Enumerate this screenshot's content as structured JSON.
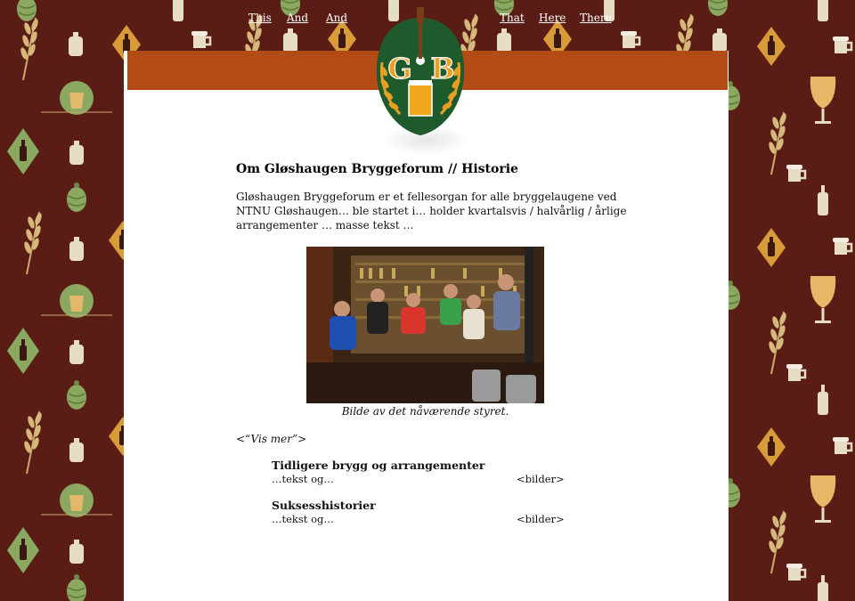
{
  "nav": {
    "left": [
      "This",
      "And",
      "And"
    ],
    "right": [
      "That",
      "Here",
      "There"
    ]
  },
  "logo": {
    "letters": [
      "G",
      "B"
    ]
  },
  "main": {
    "title": "Om Gløshaugen Bryggeforum // Historie",
    "intro": "Gløshaugen Bryggeforum er et fellesorgan for alle bryggelaugene ved NTNU Gløshaugen… ble startet i… holder kvartalsvis / halvårlig / årlige arrangementer … masse tekst …",
    "caption": "Bilde av det nåværende styret.",
    "vis_mer": "<“Vis mer”>",
    "sections": [
      {
        "heading": "Tidligere brygg og arrangementer",
        "text": "…tekst og…",
        "images": "<bilder>"
      },
      {
        "heading": "Suksesshistorier",
        "text": "…tekst og…",
        "images": "<bilder>"
      }
    ]
  },
  "colors": {
    "background": "#5a1d16",
    "navbar": "#b34b14",
    "logo_green": "#1f5a2c",
    "logo_gold": "#e8a020"
  }
}
